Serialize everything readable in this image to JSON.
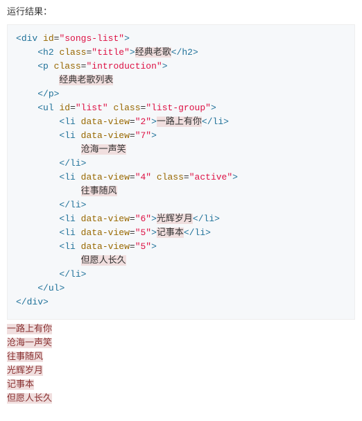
{
  "heading": "运行结果：",
  "code": {
    "div_id": "songs-list",
    "h2_class": "title",
    "h2_text": "经典老歌",
    "p_class": "introduction",
    "p_text": "经典老歌列表",
    "ul_id": "list",
    "ul_class": "list-group",
    "items": [
      {
        "dv": "2",
        "cls": "",
        "text": "一路上有你",
        "inline": true
      },
      {
        "dv": "7",
        "cls": "",
        "text": "沧海一声笑",
        "inline": false
      },
      {
        "dv": "4",
        "cls": "active",
        "text": "往事随风",
        "inline": false
      },
      {
        "dv": "6",
        "cls": "",
        "text": "光辉岁月",
        "inline": true
      },
      {
        "dv": "5",
        "cls": "",
        "text": "记事本",
        "inline": true
      },
      {
        "dv": "5",
        "cls": "",
        "text": "但愿人长久",
        "inline": false
      }
    ]
  },
  "output_lines": [
    "一路上有你",
    "沧海一声笑",
    "往事随风",
    "光辉岁月",
    "记事本",
    "但愿人长久"
  ]
}
